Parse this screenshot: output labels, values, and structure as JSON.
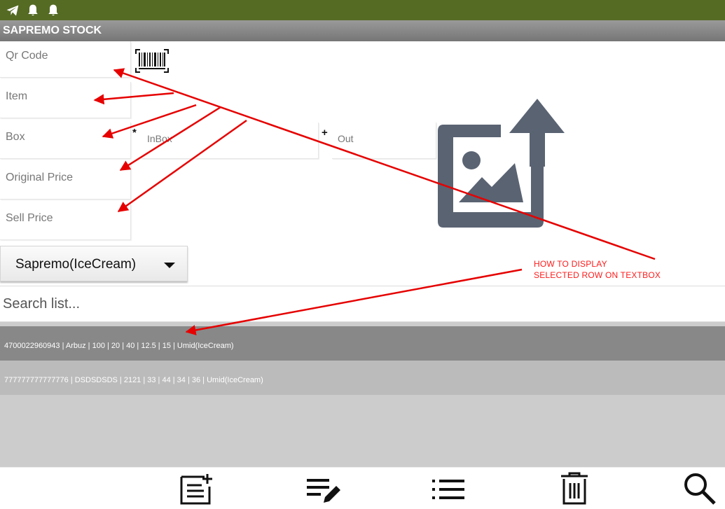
{
  "app": {
    "title": "SAPREMO STOCK"
  },
  "status_bar": {
    "icons": [
      "telegram-icon",
      "bell-icon",
      "bell-icon"
    ]
  },
  "form": {
    "qr_code_placeholder": "Qr Code",
    "item_placeholder": "Item",
    "box_placeholder": "Box",
    "multiply_symbol": "*",
    "inbox_placeholder": "InBox",
    "plus_symbol": "+",
    "out_placeholder": "Out",
    "original_price_placeholder": "Original Price",
    "sell_price_placeholder": "Sell Price"
  },
  "dropdown": {
    "selected": "Sapremo(IceCream)"
  },
  "search": {
    "placeholder": "Search list..."
  },
  "list": {
    "rows": [
      {
        "text": "4700022960943  |  Arbuz  |  100  |  20  |  40  |  12.5  |  15  |  Umid(IceCream)",
        "background": "#888888"
      },
      {
        "text": "777777777777776  |  DSDSDSDS  |  2121  |  33  |  44  |  34  |  36  |  Umid(IceCream)",
        "background": "#bbbbbb"
      }
    ]
  },
  "annotation": {
    "line1": "HOW TO DISPLAY",
    "line2": "SELECTED ROW ON TEXTBOX",
    "color": "#ff1a1a"
  },
  "bottom_bar": {
    "icons": [
      "add-note-icon",
      "edit-list-icon",
      "list-icon",
      "delete-icon",
      "search-icon"
    ]
  },
  "colors": {
    "status_bar": "#556b24",
    "title_bar": "#888888",
    "upload_icon": "#5a6372",
    "list_background": "#cccccc"
  }
}
